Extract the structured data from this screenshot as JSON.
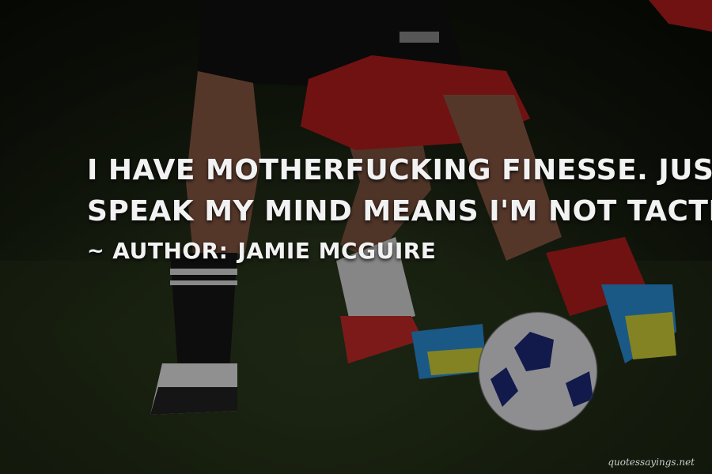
{
  "quote": {
    "line1": "I have motherfucking finesse. Just because I",
    "line2": "speak my mind means I'm not tactful?"
  },
  "author": {
    "prefix": "~",
    "label": "Author:",
    "name": "Jamie McGuire"
  },
  "watermark": {
    "text": "quotessayings.net"
  },
  "colors": {
    "text": "#f2f2f2",
    "red_kit": "#b51e1e",
    "grass": "#2b3719"
  }
}
